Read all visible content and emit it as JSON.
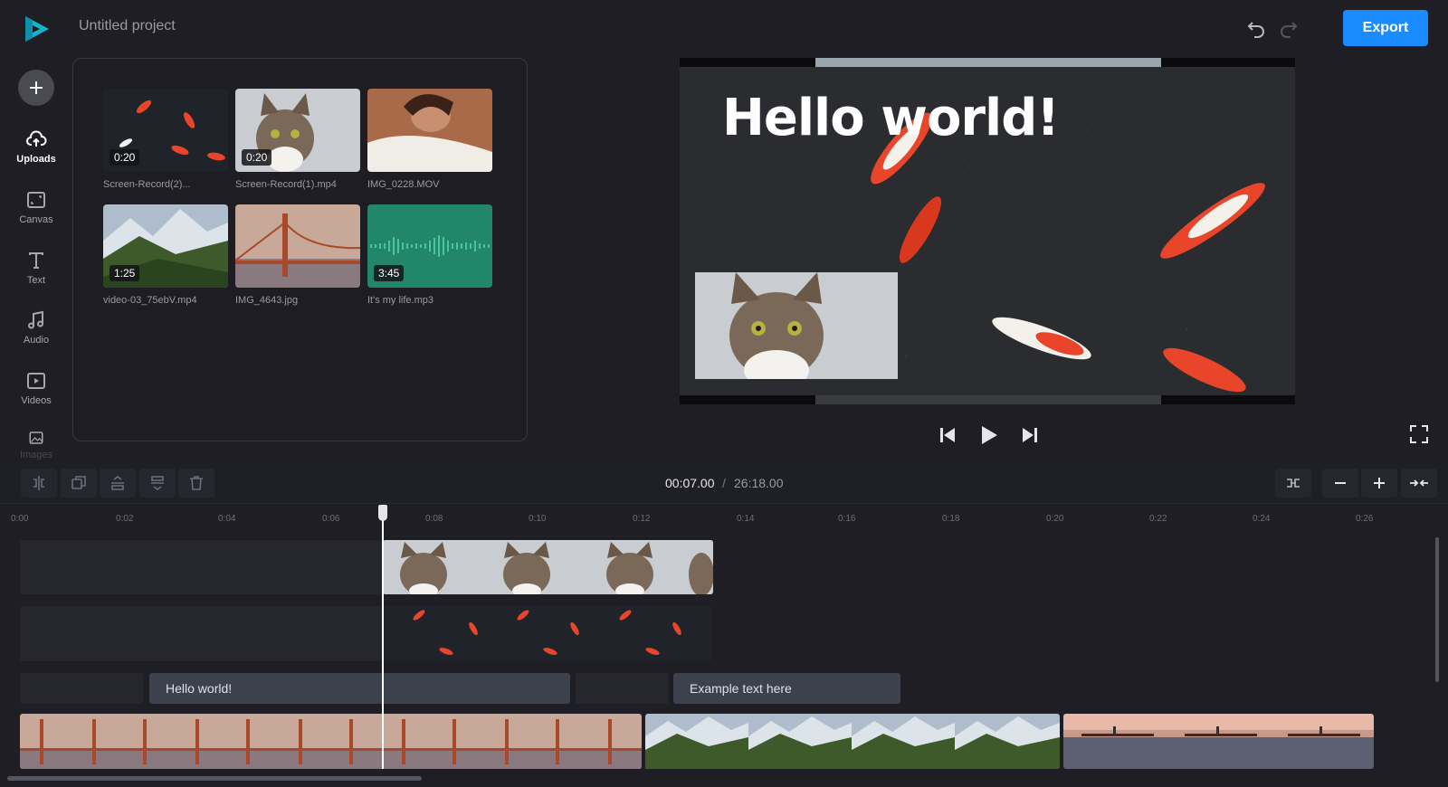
{
  "app": {
    "project_title": "Untitled project",
    "export_label": "Export",
    "accent": "#1a8cff"
  },
  "sidebar": {
    "items": [
      {
        "label": "Uploads",
        "icon": "upload-cloud-icon",
        "active": true
      },
      {
        "label": "Canvas",
        "icon": "canvas-icon"
      },
      {
        "label": "Text",
        "icon": "text-icon"
      },
      {
        "label": "Audio",
        "icon": "music-note-icon"
      },
      {
        "label": "Videos",
        "icon": "video-play-icon"
      },
      {
        "label": "Images",
        "icon": "image-icon"
      }
    ]
  },
  "media": {
    "items": [
      {
        "name": "Screen-Record(2)...",
        "duration": "0:20",
        "kind": "koi"
      },
      {
        "name": "Screen-Record(1).mp4",
        "duration": "0:20",
        "kind": "cat"
      },
      {
        "name": "IMG_0228.MOV",
        "duration": "",
        "kind": "woman"
      },
      {
        "name": "video-03_75ebV.mp4",
        "duration": "1:25",
        "kind": "mountain"
      },
      {
        "name": "IMG_4643.jpg",
        "duration": "",
        "kind": "bridge"
      },
      {
        "name": "It's my life.mp3",
        "duration": "3:45",
        "kind": "audio"
      }
    ]
  },
  "preview": {
    "overlay_text": "Hello world!"
  },
  "timeline": {
    "current_time": "00:07.00",
    "separator": "/",
    "total_time": "26:18.00",
    "ruler": [
      "0:00",
      "0:02",
      "0:04",
      "0:06",
      "0:08",
      "0:10",
      "0:12",
      "0:14",
      "0:16",
      "0:18",
      "0:20",
      "0:22",
      "0:24",
      "0:26"
    ],
    "text_clips": [
      "Hello world!",
      "Example text here"
    ]
  }
}
